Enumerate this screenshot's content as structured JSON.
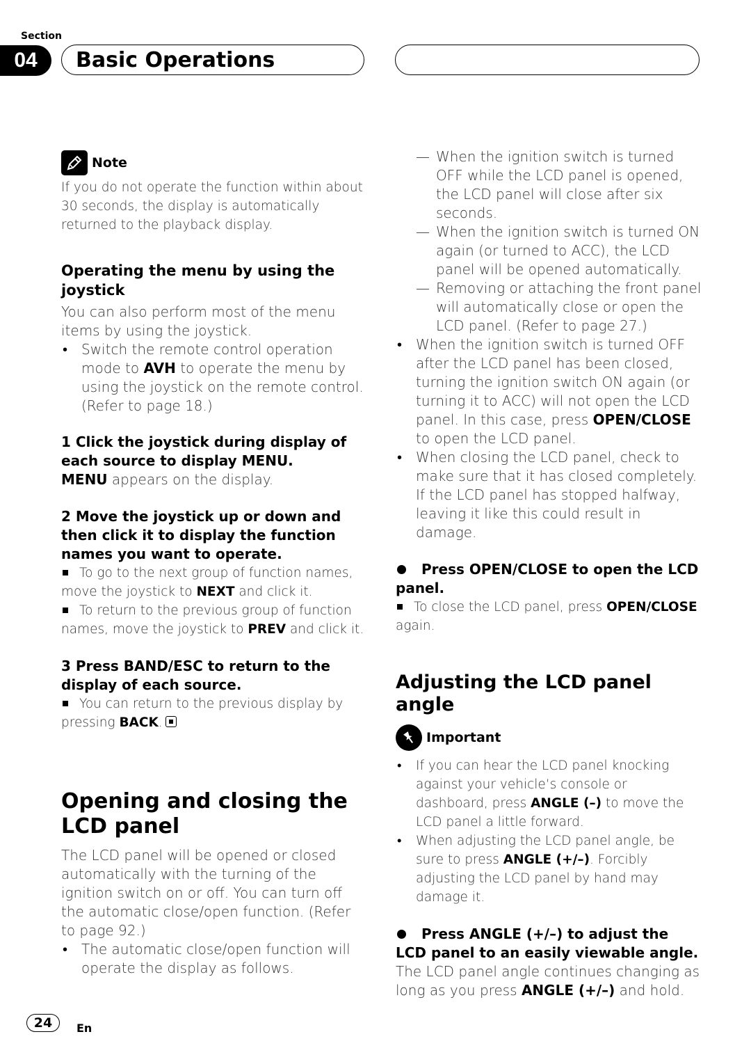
{
  "header": {
    "section_label": "Section",
    "section_number": "04",
    "title": "Basic Operations"
  },
  "left": {
    "note": {
      "label": "Note",
      "icon": "pencil-icon",
      "text": "If you do not operate the function within about 30 seconds, the display is automatically returned to the playback display."
    },
    "joystick": {
      "heading": "Operating the menu by using the joystick",
      "intro": "You can also perform most of the menu items by using the joystick.",
      "bullet_pre": "Switch the remote control operation mode to ",
      "bullet_bold": "AVH",
      "bullet_post": " to operate the menu by using the joystick on the remote control. (Refer to page 18.)"
    },
    "step1": {
      "heading": "1    Click the joystick during display of each source to display MENU.",
      "body_bold": "MENU",
      "body_post": " appears on the display."
    },
    "step2": {
      "heading": "2    Move the joystick up or down and then click it to display the function names you want to operate.",
      "note1_pre": "To go to the next group of function names, move the joystick to ",
      "note1_bold": "NEXT",
      "note1_post": " and click it.",
      "note2_pre": "To return to the previous group of function names, move the joystick to ",
      "note2_bold": "PREV",
      "note2_post": " and click it."
    },
    "step3": {
      "heading": "3    Press BAND/ESC to return to the display of each source.",
      "note_pre": "You can return to the previous display by pressing ",
      "note_bold": "BACK",
      "note_post": "."
    },
    "opening": {
      "heading": "Opening and closing the LCD panel",
      "body": "The LCD panel will be opened or closed automatically with the turning of the ignition switch on or off. You can turn off the automatic close/open function. (Refer to page 92.)",
      "bullet": "The automatic close/open function will operate the display as follows."
    }
  },
  "right": {
    "dashes": [
      "When the ignition switch is turned OFF while the LCD panel is opened, the LCD panel will close after six seconds.",
      "When the ignition switch is turned ON again (or turned to ACC), the LCD panel will be opened automatically.",
      "Removing or attaching the front panel will automatically close or open the LCD panel. (Refer to page 27.)"
    ],
    "bullet1_pre": "When the ignition switch is turned OFF after the LCD panel has been closed, turning the ignition switch ON again (or turning it to ACC) will not open the LCD panel. In this case, press ",
    "bullet1_bold": "OPEN/CLOSE",
    "bullet1_post": " to open the LCD panel.",
    "bullet2": "When closing the LCD panel, check to make sure that it has closed completely. If the LCD panel has stopped halfway, leaving it like this could result in damage.",
    "press_open": {
      "heading": "Press OPEN/CLOSE to open the LCD panel.",
      "note_pre": "To close the LCD panel, press ",
      "note_bold": "OPEN/CLOSE",
      "note_post": " again."
    },
    "angle": {
      "heading": "Adjusting the LCD panel angle",
      "important_label": "Important",
      "imp1_pre": "If you can hear the LCD panel knocking against your vehicle’s console or dashboard, press ",
      "imp1_bold": "ANGLE (–)",
      "imp1_post": " to move the LCD panel a little forward.",
      "imp2_pre": "When adjusting the LCD panel angle, be sure to press ",
      "imp2_bold": "ANGLE (+/–)",
      "imp2_post": ". Forcibly adjusting the LCD panel by hand may damage it.",
      "step_heading": "Press ANGLE (+/–) to adjust the LCD panel to an easily viewable angle.",
      "body_pre": "The LCD panel angle continues changing as long as you press ",
      "body_bold": "ANGLE (+/–)",
      "body_post": " and hold."
    }
  },
  "footer": {
    "page_number": "24",
    "language": "En"
  }
}
